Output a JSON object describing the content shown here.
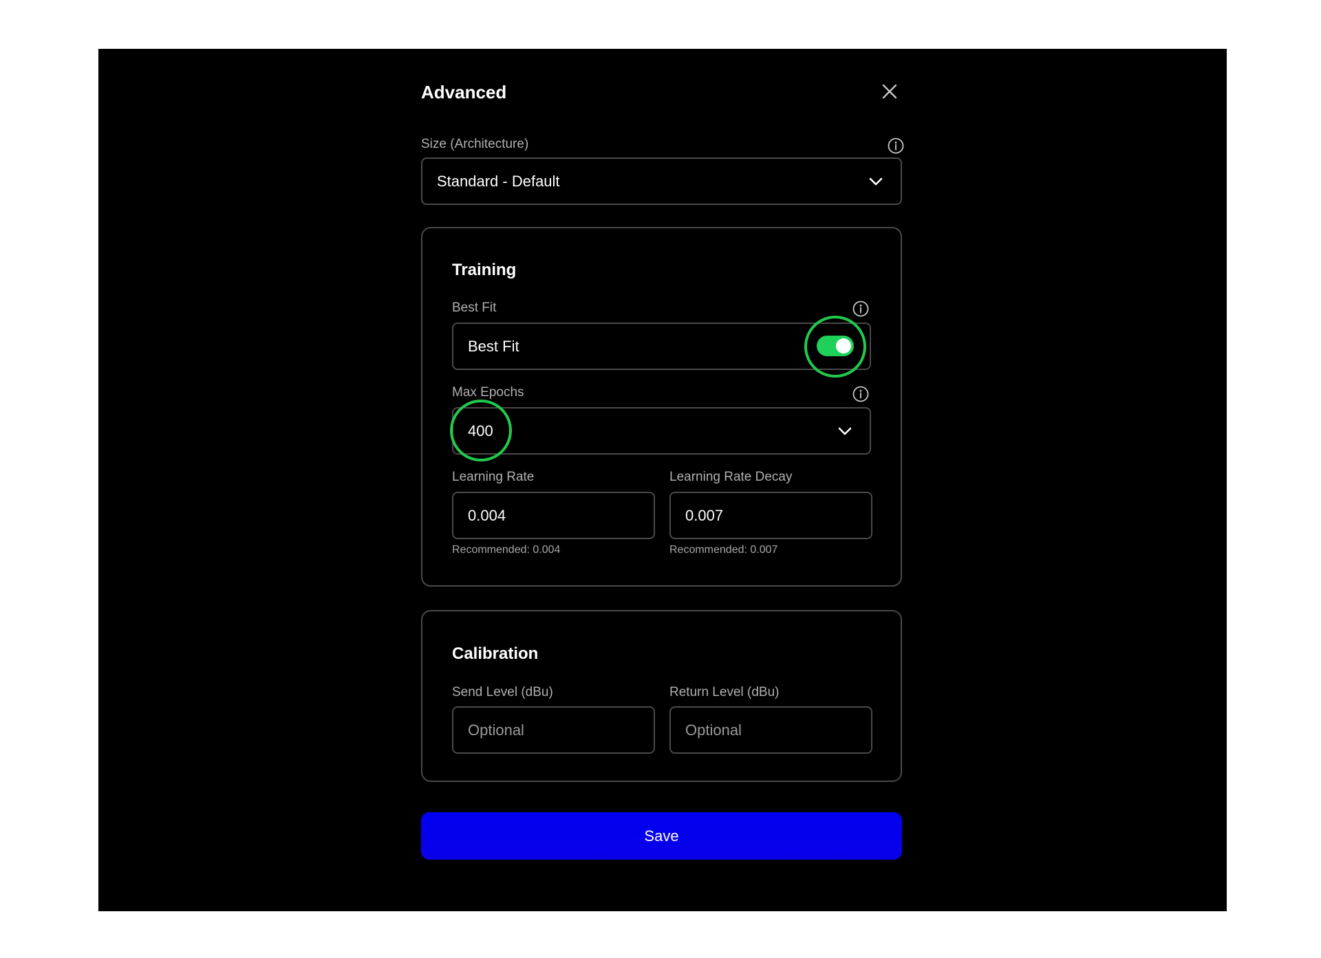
{
  "dialog": {
    "title": "Advanced",
    "close_icon": "close-icon"
  },
  "architecture": {
    "label": "Size (Architecture)",
    "value": "Standard - Default",
    "info_icon": "info-icon",
    "chevron_icon": "chevron-down-icon"
  },
  "training": {
    "title": "Training",
    "best_fit": {
      "label": "Best Fit",
      "value": "Best Fit",
      "enabled": true,
      "toggle_color": "#1fd15a"
    },
    "max_epochs": {
      "label": "Max Epochs",
      "value": "400"
    },
    "learning_rate": {
      "label": "Learning Rate",
      "value": "0.004",
      "hint": "Recommended: 0.004"
    },
    "learning_rate_decay": {
      "label": "Learning Rate Decay",
      "value": "0.007",
      "hint": "Recommended: 0.007"
    }
  },
  "calibration": {
    "title": "Calibration",
    "send_level": {
      "label": "Send Level (dBu)",
      "placeholder": "Optional"
    },
    "return_level": {
      "label": "Return Level (dBu)",
      "placeholder": "Optional"
    }
  },
  "save": {
    "label": "Save",
    "color": "#0000f0"
  },
  "annotations": {
    "highlight_color": "#22c94e"
  }
}
